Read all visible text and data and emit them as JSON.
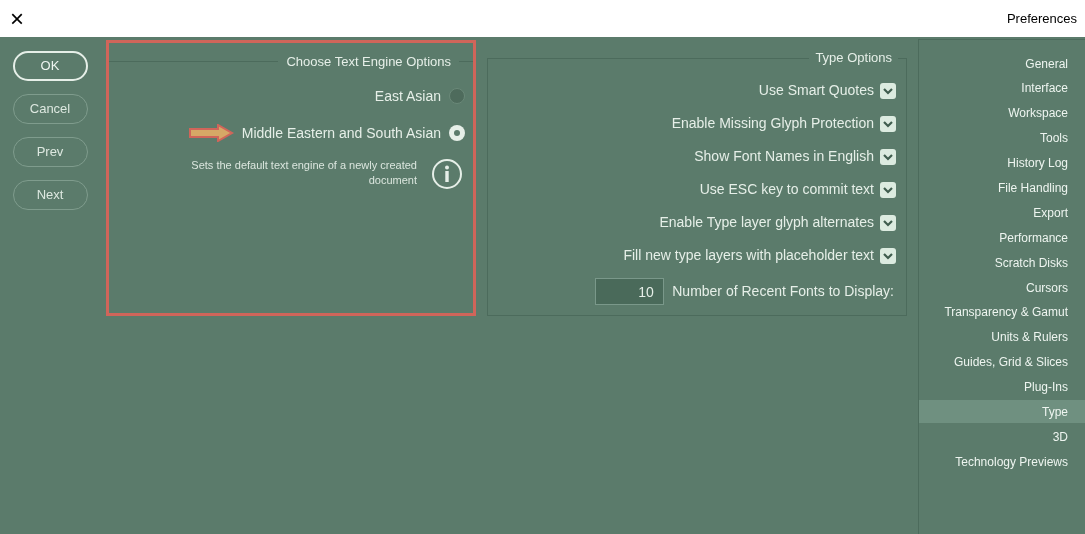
{
  "window": {
    "title": "Preferences",
    "close": "×"
  },
  "buttons": [
    {
      "label": "OK",
      "kind": "primary"
    },
    {
      "label": "Cancel",
      "kind": "normal"
    },
    {
      "label": "Prev",
      "kind": "normal"
    },
    {
      "label": "Next",
      "kind": "normal"
    }
  ],
  "text_engine": {
    "title": "Choose Text Engine Options",
    "highlighted": true,
    "options": [
      {
        "label": "East Asian",
        "selected": false
      },
      {
        "label": "Middle Eastern and South Asian",
        "selected": true,
        "arrow": true
      }
    ],
    "info": "Sets the default text engine of a newly created document"
  },
  "type_options": {
    "title": "Type Options",
    "checkboxes": [
      {
        "label": "Use Smart Quotes",
        "checked": true
      },
      {
        "label": "Enable Missing Glyph Protection",
        "checked": true
      },
      {
        "label": "Show Font Names in English",
        "checked": true
      },
      {
        "label": "Use ESC key to commit text",
        "checked": true
      },
      {
        "label": "Enable Type layer glyph alternates",
        "checked": true
      },
      {
        "label": "Fill new type layers with placeholder text",
        "checked": true
      }
    ],
    "recent_fonts": {
      "label": "Number of Recent Fonts to Display:",
      "value": "10"
    }
  },
  "sidebar": {
    "items": [
      {
        "label": "General",
        "selected": false
      },
      {
        "label": "Interface",
        "selected": false
      },
      {
        "label": "Workspace",
        "selected": false
      },
      {
        "label": "Tools",
        "selected": false
      },
      {
        "label": "History Log",
        "selected": false
      },
      {
        "label": "File Handling",
        "selected": false
      },
      {
        "label": "Export",
        "selected": false
      },
      {
        "label": "Performance",
        "selected": false
      },
      {
        "label": "Scratch Disks",
        "selected": false
      },
      {
        "label": "Cursors",
        "selected": false
      },
      {
        "label": "Transparency & Gamut",
        "selected": false
      },
      {
        "label": "Units & Rulers",
        "selected": false
      },
      {
        "label": "Guides, Grid & Slices",
        "selected": false
      },
      {
        "label": "Plug-Ins",
        "selected": false
      },
      {
        "label": "Type",
        "selected": true
      },
      {
        "label": "3D",
        "selected": false
      },
      {
        "label": "Technology Previews",
        "selected": false
      }
    ]
  }
}
